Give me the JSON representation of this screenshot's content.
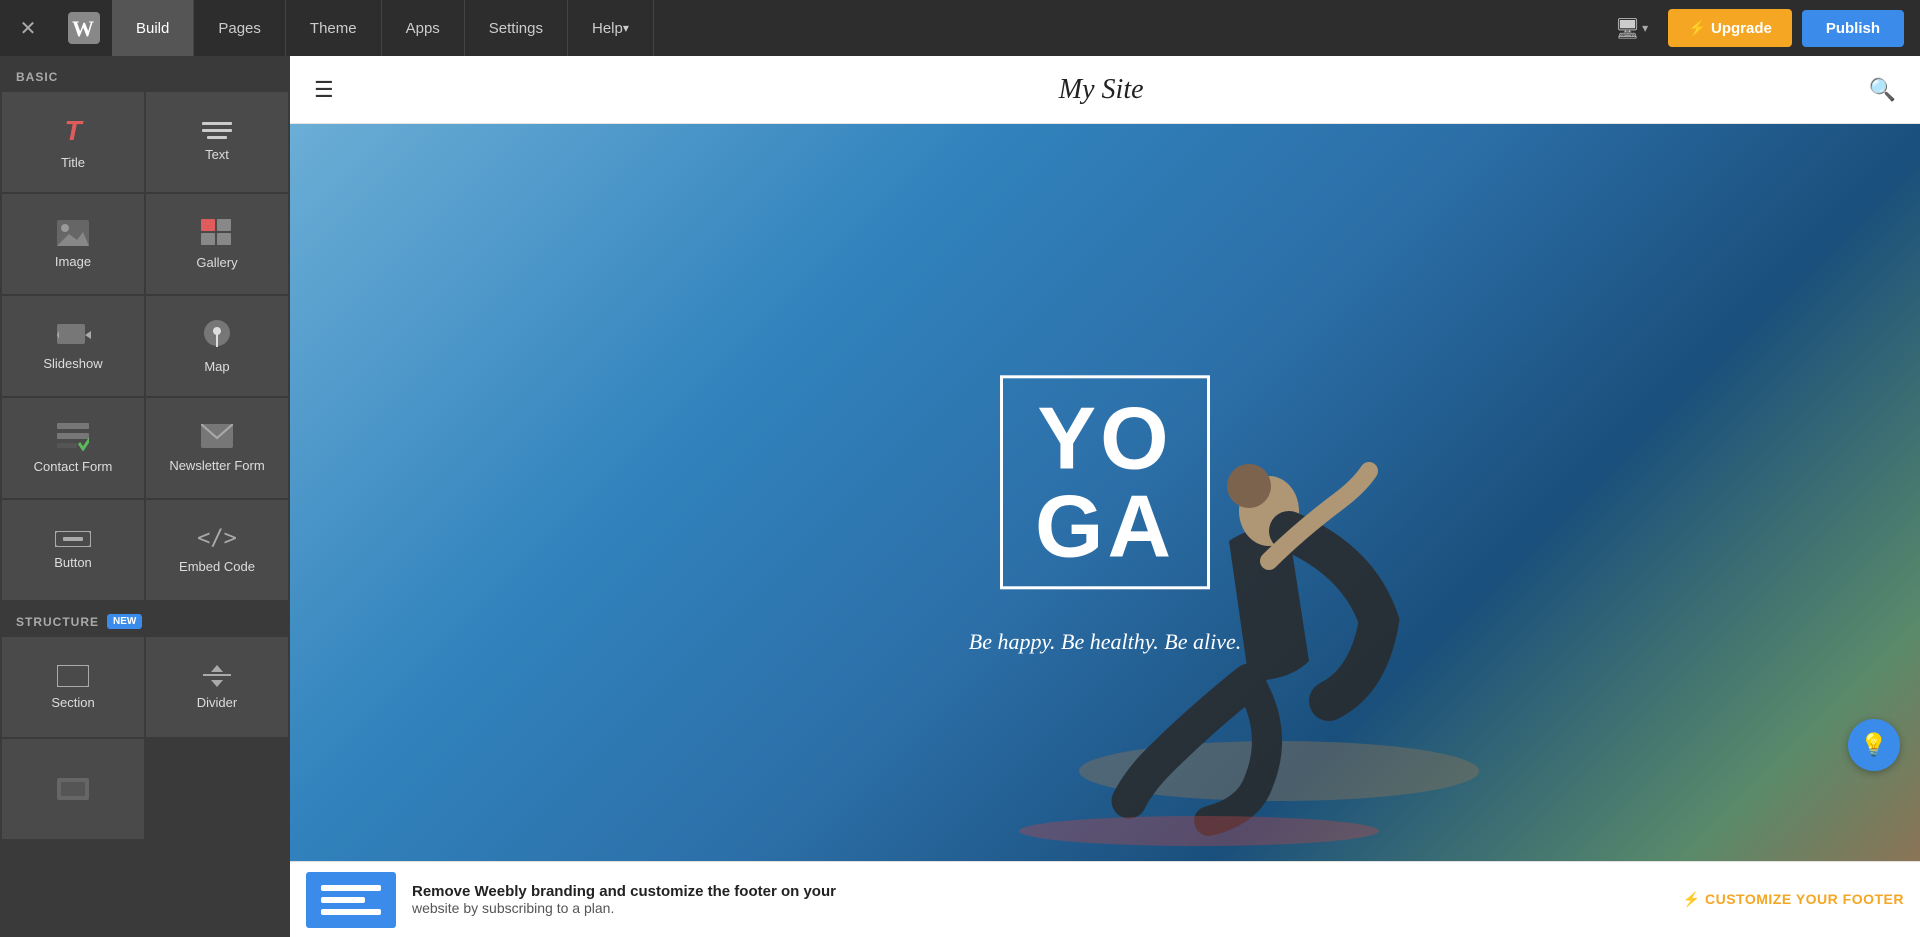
{
  "nav": {
    "tabs": [
      {
        "id": "build",
        "label": "Build",
        "active": true
      },
      {
        "id": "pages",
        "label": "Pages",
        "active": false
      },
      {
        "id": "theme",
        "label": "Theme",
        "active": false
      },
      {
        "id": "apps",
        "label": "Apps",
        "active": false
      },
      {
        "id": "settings",
        "label": "Settings",
        "active": false
      },
      {
        "id": "help",
        "label": "Help",
        "active": false,
        "has_arrow": true
      }
    ],
    "upgrade_label": "⚡ Upgrade",
    "publish_label": "Publish",
    "device_icon": "🖥"
  },
  "sidebar": {
    "basic_label": "BASIC",
    "items_basic": [
      {
        "id": "title",
        "label": "Title",
        "icon_type": "title"
      },
      {
        "id": "text",
        "label": "Text",
        "icon_type": "text"
      },
      {
        "id": "image",
        "label": "Image",
        "icon_type": "image"
      },
      {
        "id": "gallery",
        "label": "Gallery",
        "icon_type": "gallery"
      },
      {
        "id": "slideshow",
        "label": "Slideshow",
        "icon_type": "slideshow"
      },
      {
        "id": "map",
        "label": "Map",
        "icon_type": "map"
      },
      {
        "id": "contact-form",
        "label": "Contact Form",
        "icon_type": "form"
      },
      {
        "id": "newsletter-form",
        "label": "Newsletter Form",
        "icon_type": "newsletter"
      },
      {
        "id": "button",
        "label": "Button",
        "icon_type": "button"
      },
      {
        "id": "embed-code",
        "label": "Embed Code",
        "icon_type": "embed"
      }
    ],
    "structure_label": "STRUCTURE",
    "new_badge": "NEW",
    "items_structure": [
      {
        "id": "section",
        "label": "Section",
        "icon_type": "section"
      },
      {
        "id": "divider",
        "label": "Divider",
        "icon_type": "divider"
      }
    ]
  },
  "site": {
    "title": "My Site",
    "hamburger_icon": "☰",
    "search_icon": "🔍"
  },
  "hero": {
    "yoga_line1": "YO",
    "yoga_line2": "GA",
    "tagline": "Be happy. Be healthy. Be alive."
  },
  "footer_banner": {
    "main_text": "Remove Weebly branding and customize the footer on your",
    "sub_text": "website by subscribing to a plan.",
    "cta_label": "⚡ CUSTOMIZE YOUR FOOTER",
    "preview_lines": [
      60,
      45,
      60
    ]
  },
  "floating_btn": {
    "icon": "💡"
  }
}
